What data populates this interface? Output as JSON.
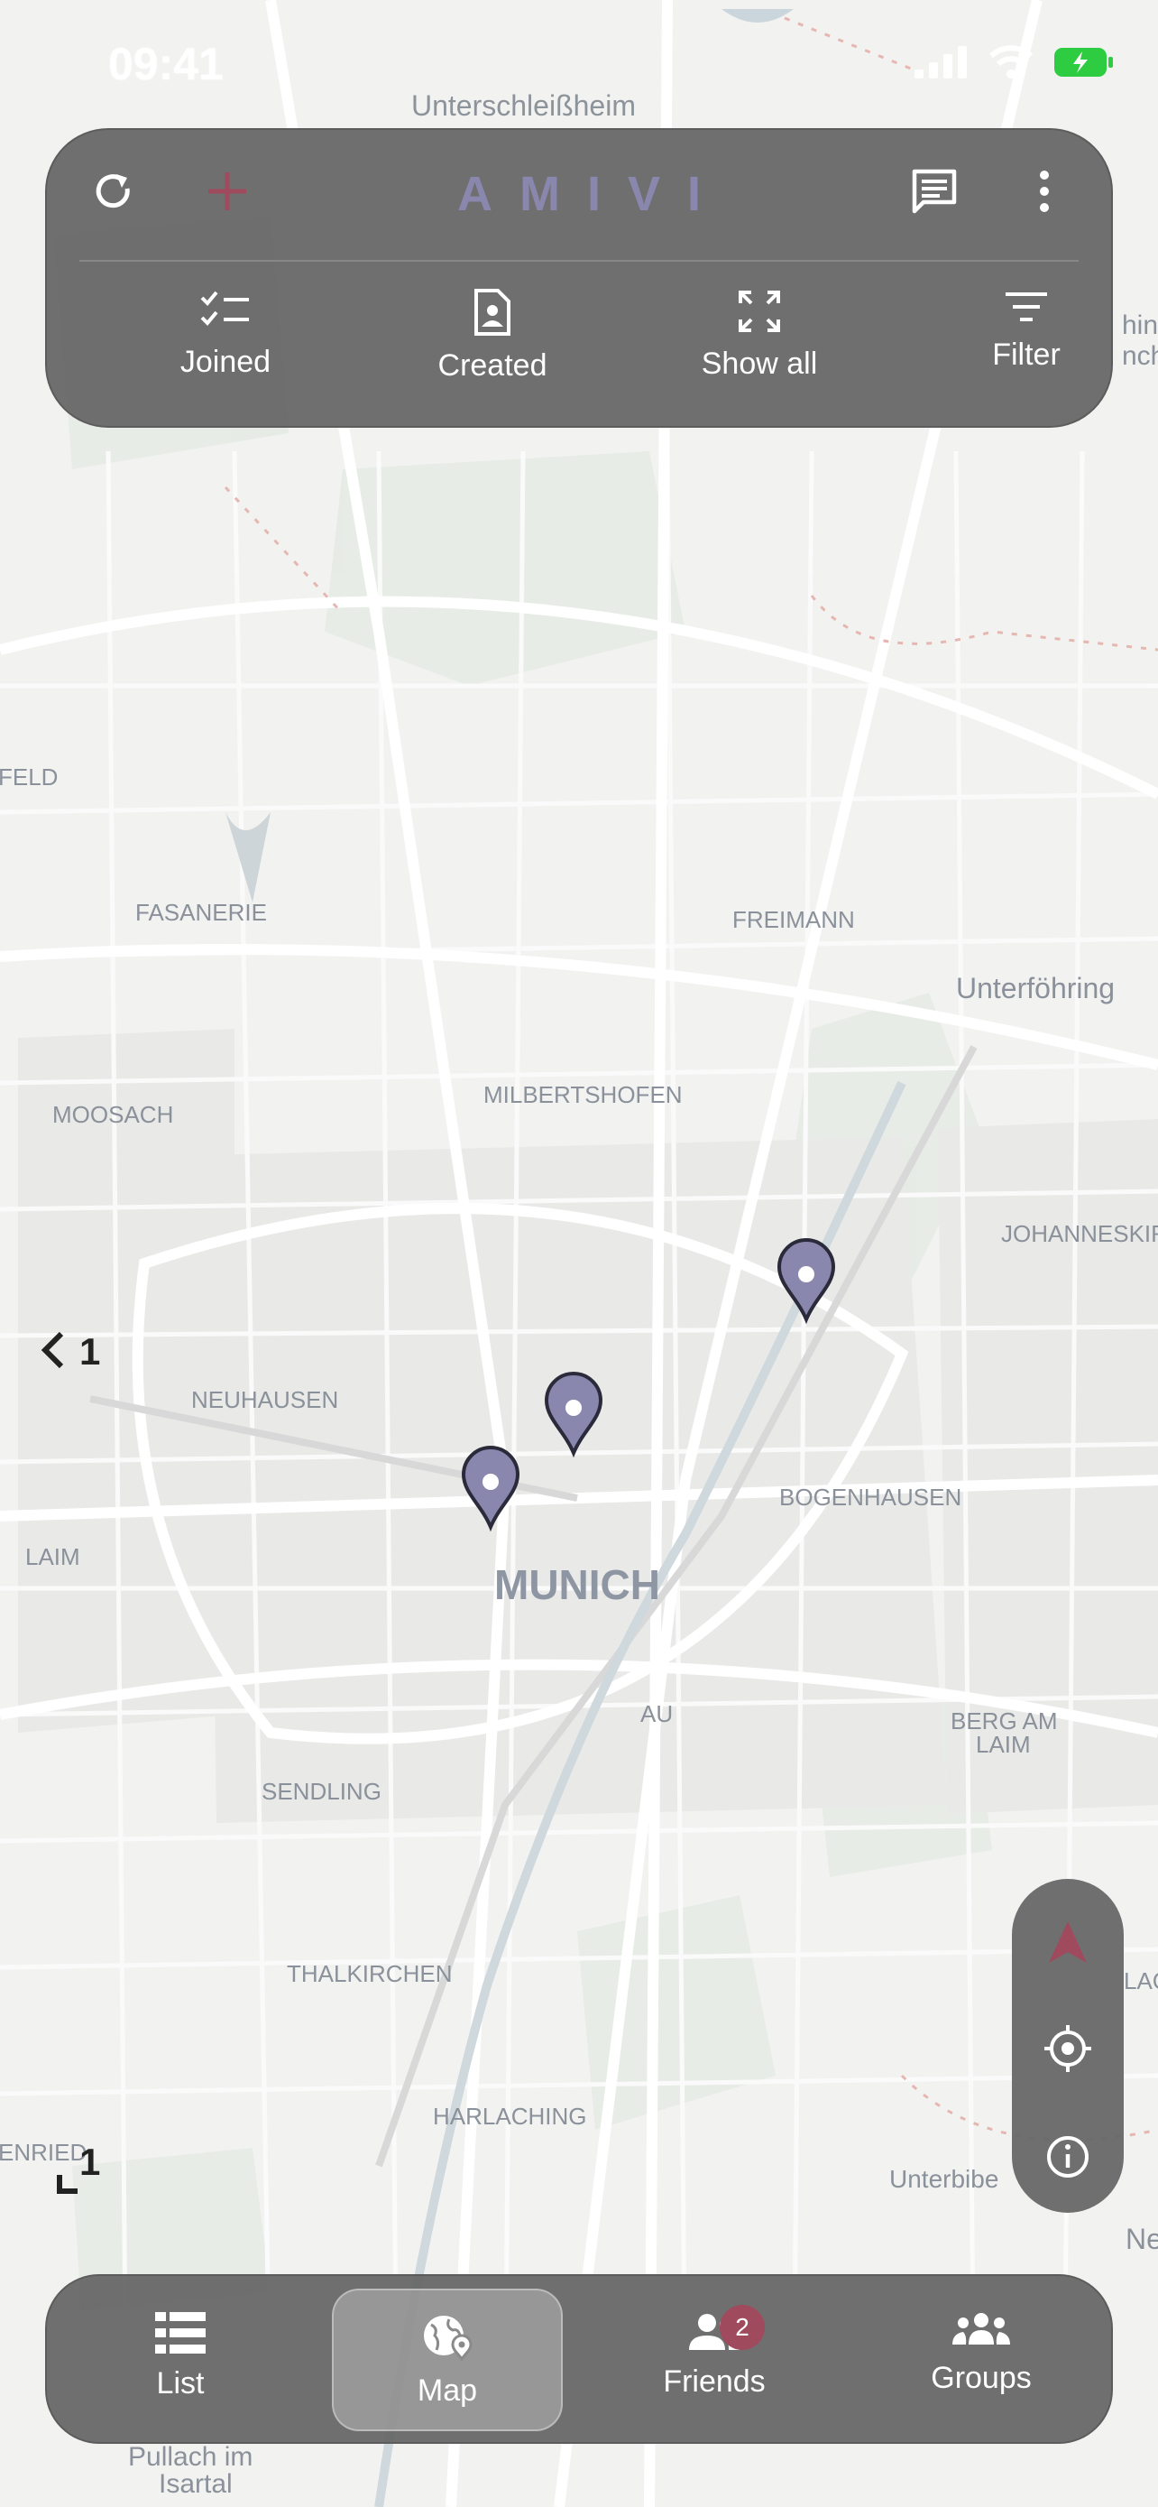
{
  "status_bar": {
    "time": "09:41"
  },
  "toolbar": {
    "brand": "AMIVI",
    "refresh_icon": "refresh-icon",
    "add_icon": "plus-icon",
    "chat_icon": "chat-icon",
    "more_icon": "more-vertical-icon"
  },
  "filters": [
    {
      "label": "Joined",
      "icon": "checklist-icon"
    },
    {
      "label": "Created",
      "icon": "document-user-icon"
    },
    {
      "label": "Show all",
      "icon": "expand-icon"
    },
    {
      "label": "Filter",
      "icon": "filter-icon"
    }
  ],
  "map": {
    "city_label": "MUNICH",
    "district_labels": [
      "Unterschleißheim",
      "FELD",
      "FASANERIE",
      "FREIMANN",
      "Unterföhring",
      "MOOSACH",
      "MILBERTSHOFEN",
      "JOHANNESKIR",
      "NEUHAUSEN",
      "BOGENHAUSEN",
      "LAIM",
      "AU",
      "BERG AM",
      "LAIM",
      "SENDLING",
      "THALKIRCHEN",
      "HARLACHING",
      "ENRIED",
      "Unterbibe",
      "Ne",
      "Pullach im",
      "Isartal",
      "hing",
      "nch",
      "LAC"
    ],
    "cluster_left_top": "1",
    "cluster_left_bottom": "1",
    "pin_color": "#8a87ae"
  },
  "map_controls": [
    "compass-icon",
    "locate-icon",
    "info-icon"
  ],
  "nav": {
    "items": [
      {
        "label": "List",
        "icon": "list-icon"
      },
      {
        "label": "Map",
        "icon": "globe-pin-icon"
      },
      {
        "label": "Friends",
        "icon": "friends-icon",
        "badge": "2"
      },
      {
        "label": "Groups",
        "icon": "groups-icon"
      }
    ]
  },
  "colors": {
    "panel": "#666666",
    "brand": "#8a87ae",
    "accent": "#a04a5e"
  }
}
